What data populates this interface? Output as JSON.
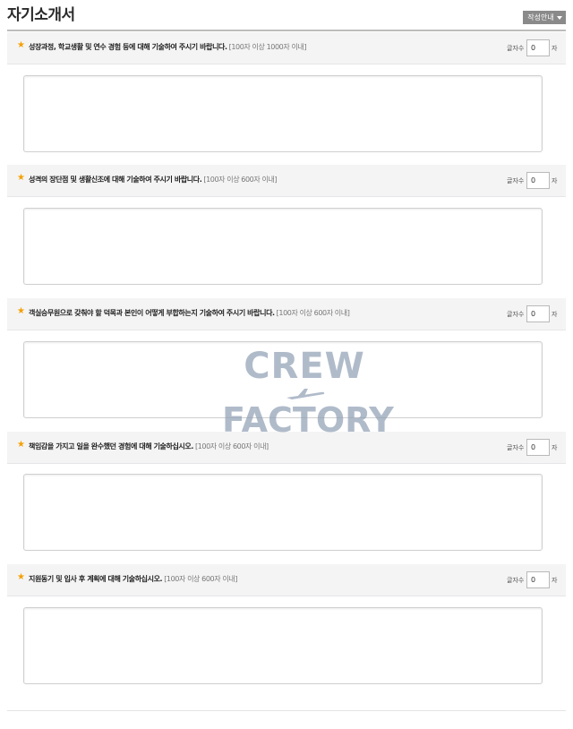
{
  "page": {
    "title": "자기소개서",
    "guide_button_label": "작성안내"
  },
  "questions": [
    {
      "prompt": "성장과정, 학교생활 및 연수 경험 등에 대해 기술하여 주시기 바랍니다.",
      "limit": "[100자 이상 1000자 이내]",
      "count_label": "글자수",
      "count_value": "0",
      "count_unit": "자",
      "answer": ""
    },
    {
      "prompt": "성격의 장단점 및 생활신조에 대해 기술하여 주시기 바랍니다.",
      "limit": "[100자 이상 600자 이내]",
      "count_label": "글자수",
      "count_value": "0",
      "count_unit": "자",
      "answer": ""
    },
    {
      "prompt": "객실승무원으로 갖춰야 할 덕목과 본인이 어떻게 부합하는지 기술하여 주시기 바랍니다.",
      "limit": "[100자 이상 600자 이내]",
      "count_label": "글자수",
      "count_value": "0",
      "count_unit": "자",
      "answer": ""
    },
    {
      "prompt": "책임감을 가지고 일을 완수했던 경험에 대해 기술하십시오.",
      "limit": "[100자 이상 600자 이내]",
      "count_label": "글자수",
      "count_value": "0",
      "count_unit": "자",
      "answer": ""
    },
    {
      "prompt": "지원동기 및 입사 후 계획에 대해 기술하십시오.",
      "limit": "[100자 이상 600자 이내]",
      "count_label": "글자수",
      "count_value": "0",
      "count_unit": "자",
      "answer": ""
    }
  ],
  "icons": {
    "required_marker": "star-icon",
    "guide_dropdown": "caret-down-icon"
  },
  "colors": {
    "star": "#f5a000",
    "guide_button_bg": "#8a8a8a",
    "header_bg": "#f4f4f5",
    "watermark": "#8f9fb4"
  },
  "watermark": {
    "line1": "CREW",
    "line2": "FACTORY"
  }
}
